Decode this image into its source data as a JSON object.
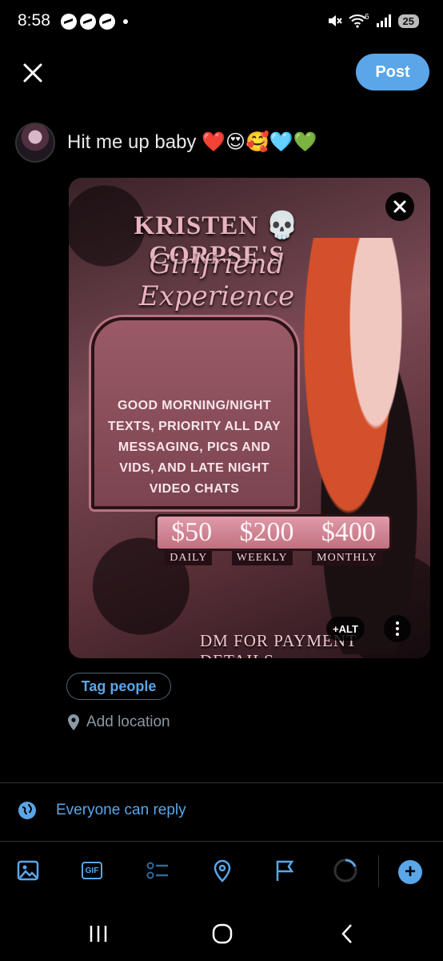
{
  "status_bar": {
    "time": "8:58",
    "network": "6",
    "battery": "25"
  },
  "header": {
    "post_label": "Post"
  },
  "composer": {
    "text": "Hit me up baby ❤️😍🥰🩵💚"
  },
  "media": {
    "title": "KRISTEN 💀 CORPSE'S",
    "subtitle": "Girlfriend Experience",
    "body": "GOOD MORNING/NIGHT TEXTS, PRIORITY ALL DAY MESSAGING, PICS AND VIDS, AND LATE NIGHT VIDEO CHATS",
    "prices": [
      {
        "amount": "$50",
        "period": "DAILY"
      },
      {
        "amount": "$200",
        "period": "WEEKLY"
      },
      {
        "amount": "$400",
        "period": "MONTHLY"
      }
    ],
    "footer": "DM FOR PAYMENT DETAILS",
    "alt_label": "+ALT"
  },
  "tag_people": "Tag people",
  "add_location": "Add location",
  "reply_setting": "Everyone can reply",
  "colors": {
    "accent": "#5aa6e8",
    "background": "#000000",
    "muted": "#8b98a5"
  }
}
